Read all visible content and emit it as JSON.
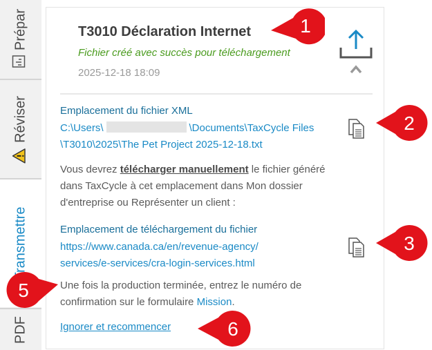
{
  "tabs": {
    "prep": "Prépar",
    "review": "Réviser",
    "transmit": "Transmettre",
    "pdf": "PDF"
  },
  "header": {
    "title": "T3010 Déclaration Internet",
    "subtitle": "Fichier créé avec succès pour téléchargement",
    "timestamp": "2025-12-18 18:09"
  },
  "xml": {
    "label": "Emplacement du fichier XML",
    "path_prefix": "C:\\Users\\",
    "path_suffix": "\\Documents\\TaxCycle Files",
    "path_line2": "\\T3010\\2025\\The Pet Project 2025-12-18.txt"
  },
  "instructions": {
    "text_before": "Vous devrez ",
    "emphasis": "télécharger manuellement",
    "text_after": " le fichier généré dans TaxCycle à cet emplacement dans  Mon dossier d'entreprise ou Représenter un client :"
  },
  "upload_location": {
    "label": "Emplacement de téléchargement du fichier",
    "url_line1": "https://www.canada.ca/en/revenue-agency/",
    "url_line2": "services/e-services/cra-login-services.html"
  },
  "completion": {
    "text": "Une fois la production terminée, entrez le numéro de confirmation sur le formulaire ",
    "link": "Mission",
    "end": "."
  },
  "reset_link": "Ignorer et recommencer",
  "callouts": [
    "1",
    "2",
    "3",
    "5",
    "6"
  ],
  "colors": {
    "accent": "#1a8ac6",
    "success": "#4a9b1e",
    "callout_red": "#e2131b"
  }
}
